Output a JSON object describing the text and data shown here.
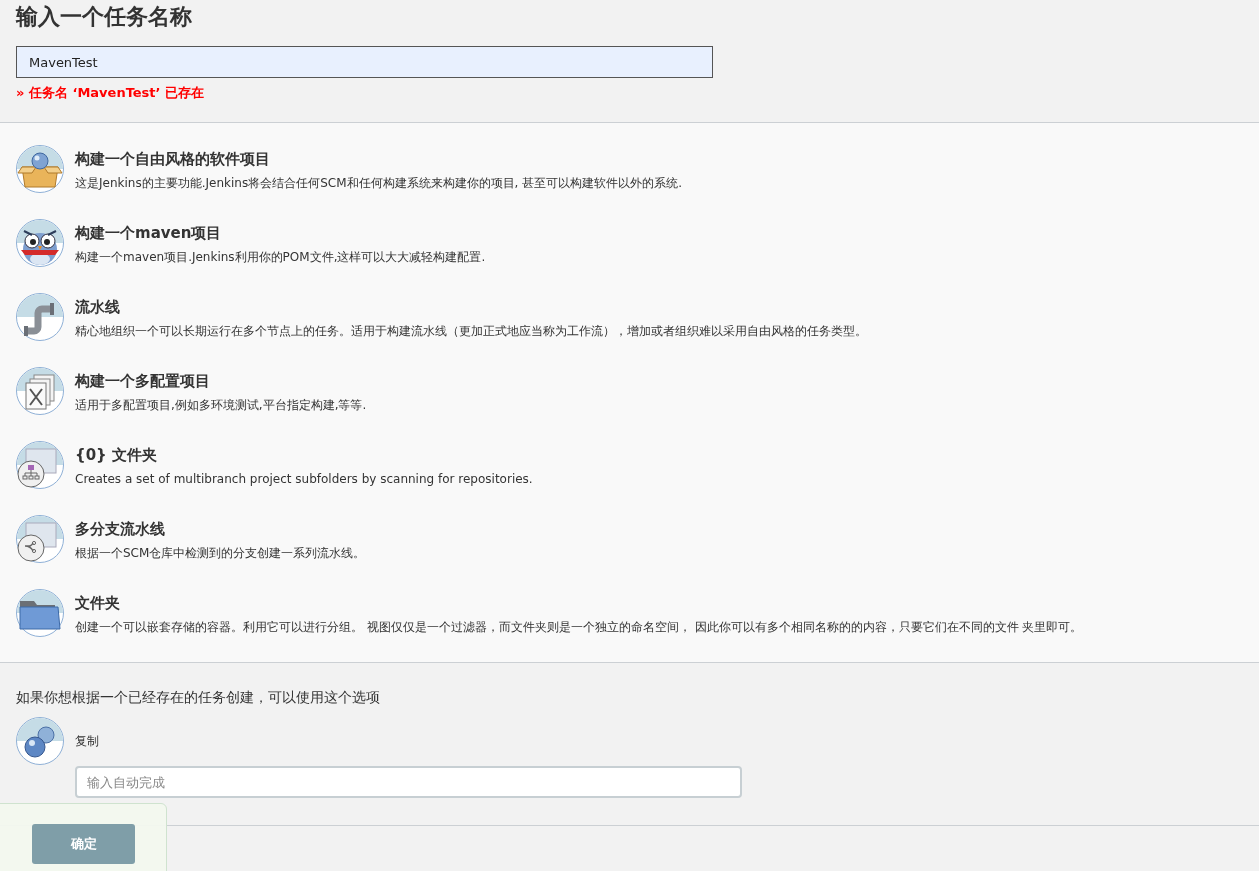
{
  "title": "输入一个任务名称",
  "name_field": {
    "value": "MavenTest"
  },
  "error": "» 任务名 ‘MavenTest’ 已存在",
  "items": [
    {
      "kind": "freestyle",
      "title": "构建一个自由风格的软件项目",
      "description": "这是Jenkins的主要功能.Jenkins将会结合任何SCM和任何构建系统来构建你的项目, 甚至可以构建软件以外的系统."
    },
    {
      "kind": "maven",
      "title": "构建一个maven项目",
      "description": "构建一个maven项目.Jenkins利用你的POM文件,这样可以大大减轻构建配置."
    },
    {
      "kind": "pipeline",
      "title": "流水线",
      "description": "精心地组织一个可以长期运行在多个节点上的任务。适用于构建流水线（更加正式地应当称为工作流），增加或者组织难以采用自由风格的任务类型。"
    },
    {
      "kind": "matrix",
      "title": "构建一个多配置项目",
      "description": "适用于多配置项目,例如多环境测试,平台指定构建,等等."
    },
    {
      "kind": "org-folder",
      "title": "{0} 文件夹",
      "description": "Creates a set of multibranch project subfolders by scanning for repositories."
    },
    {
      "kind": "multibranch",
      "title": "多分支流水线",
      "description": "根据一个SCM仓库中检测到的分支创建一系列流水线。"
    },
    {
      "kind": "folder",
      "title": "文件夹",
      "description": "创建一个可以嵌套存储的容器。利用它可以进行分组。 视图仅仅是一个过滤器，而文件夹则是一个独立的命名空间， 因此你可以有多个相同名称的的内容，只要它们在不同的文件 夹里即可。"
    }
  ],
  "copy": {
    "hint": "如果你想根据一个已经存在的任务创建，可以使用这个选项",
    "label": "复制",
    "placeholder": "输入自动完成"
  },
  "ok_button": "确定"
}
